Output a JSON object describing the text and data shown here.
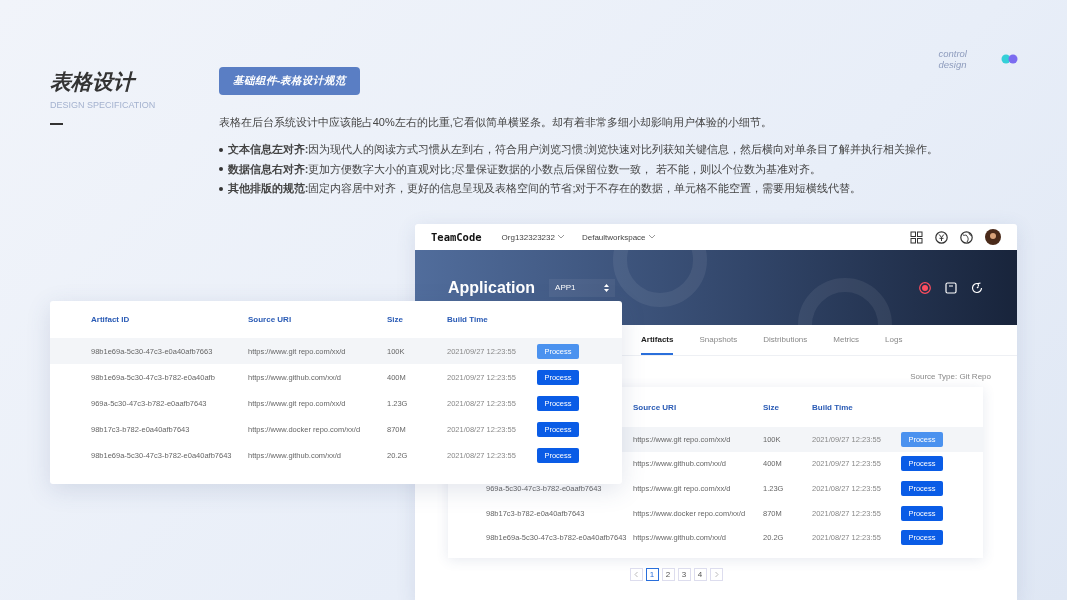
{
  "title": "表格设计",
  "subtitle": "DESIGN SPECIFICATION",
  "badge": "基础组件-表格设计规范",
  "brand": "control design",
  "intro": "表格在后台系统设计中应该能占40%左右的比重,它看似简单横竖条。却有着非常多细小却影响用户体验的小细节。",
  "bullets": [
    "**文本信息左对齐:**因为现代人的阅读方式习惯从左到右，符合用户浏览习惯:浏览快速对比列获知关键信息，然后横向对单条目了解并执行相关操作。",
    "**数据信息右对齐:**更加方便数字大小的直观对比;尽量保证数据的小数点后保留位数一致，  若不能，则以个位数为基准对齐。",
    "**其他排版的规范:**固定内容居中对齐，更好的信息呈现及表格空间的节省;对于不存在的数据，单元格不能空置，需要用短横线代替。"
  ],
  "app_window": {
    "logo": "TeamCode",
    "org": "Org132323232",
    "workspace": "Defaultworkspace",
    "title": "Application",
    "app_select": "APP1",
    "tabs": [
      {
        "label": "Artifacts",
        "selected": true
      },
      {
        "label": "Snapshots",
        "selected": false
      },
      {
        "label": "Distributions",
        "selected": false
      },
      {
        "label": "Metrics",
        "selected": false
      },
      {
        "label": "Logs",
        "selected": false
      }
    ],
    "source_type": "Source Type: Git Repo",
    "table": {
      "columns": [
        "Source URI",
        "Size",
        "Build Time"
      ],
      "rows": [
        {
          "source_uri": "https://www.git repo.com/xx/d",
          "size": "100K",
          "build_time": "2021/09/27 12:23:55",
          "action": "Process",
          "highlighted": true
        },
        {
          "source_uri": "https://www.github.com/xx/d",
          "size": "400M",
          "build_time": "2021/09/27 12:23:55",
          "action": "Process",
          "highlighted": false
        },
        {
          "artifact_id": "969a-5c30-47c3-b782-e0aafb7643",
          "source_uri": "https://www.git repo.com/xx/d",
          "size": "1.23G",
          "build_time": "2021/08/27 12:23:55",
          "action": "Process",
          "highlighted": false
        },
        {
          "artifact_id": "98b17c3-b782-e0a40afb7643",
          "source_uri": "https://www.docker repo.com/xx/d",
          "size": "870M",
          "build_time": "2021/08/27 12:23:55",
          "action": "Process",
          "highlighted": false
        },
        {
          "artifact_id": "98b1e69a-5c30-47c3-b782-e0a40afb7643",
          "source_uri": "https://www.github.com/xx/d",
          "size": "20.2G",
          "build_time": "2021/08/27 12:23:55",
          "action": "Process",
          "highlighted": false
        }
      ]
    },
    "pagination": [
      {
        "label": "1",
        "selected": true
      },
      {
        "label": "2",
        "selected": false
      },
      {
        "label": "3",
        "selected": false
      },
      {
        "label": "4",
        "selected": false
      }
    ]
  },
  "front_table": {
    "columns": [
      "Artifact ID",
      "Source URI",
      "Size",
      "Build Time"
    ],
    "rows": [
      {
        "artifact_id": "98b1e69a-5c30-47c3-e0a40afb7663",
        "source_uri": "https://www.git repo.com/xx/d",
        "size": "100K",
        "build_time": "2021/09/27 12:23:55",
        "action": "Process",
        "highlighted": true
      },
      {
        "artifact_id": "98b1e69a-5c30-47c3-b782-e0a40afb",
        "source_uri": "https://www.github.com/xx/d",
        "size": "400M",
        "build_time": "2021/09/27 12:23:55",
        "action": "Process",
        "highlighted": false
      },
      {
        "artifact_id": "969a-5c30-47c3-b782-e0aafb7643",
        "source_uri": "https://www.git repo.com/xx/d",
        "size": "1.23G",
        "build_time": "2021/08/27 12:23:55",
        "action": "Process",
        "highlighted": false
      },
      {
        "artifact_id": "98b17c3-b782-e0a40afb7643",
        "source_uri": "https://www.docker repo.com/xx/d",
        "size": "870M",
        "build_time": "2021/08/27 12:23:55",
        "action": "Process",
        "highlighted": false
      },
      {
        "artifact_id": "98b1e69a-5c30-47c3-b782-e0a40afb7643",
        "source_uri": "https://www.github.com/xx/d",
        "size": "20.2G",
        "build_time": "2021/08/27 12:23:55",
        "action": "Process",
        "highlighted": false
      }
    ]
  }
}
